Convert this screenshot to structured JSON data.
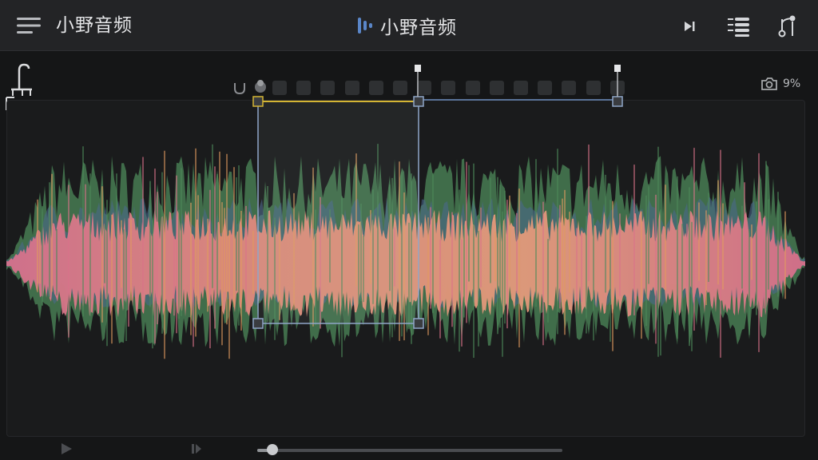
{
  "header": {
    "app_title": "小野音频",
    "center_title": "小野音频",
    "icons": {
      "menu": "hamburger-menu-icon",
      "logo": "audio-bars-logo-icon",
      "play_next": "skip-forward-icon",
      "tracks": "track-list-icon",
      "tools": "branch-tool-icon"
    }
  },
  "editor": {
    "zoom_level": "9%",
    "marker_icon": "split-marker-icon",
    "magnet_icon": "snap-magnet-icon",
    "camera_icon": "snapshot-camera-icon",
    "selection": {
      "start": 0.316,
      "end": 0.512
    },
    "colors": {
      "wave_primary": "#d9728a",
      "wave_secondary": "#4e8a5a",
      "wave_blue": "#4a6890",
      "wave_highlight": "#e09a60",
      "selection_primary": "#d4b534",
      "selection_secondary": "#8fa6c8"
    }
  },
  "transport": {
    "play_icon": "play-icon",
    "pause_icon": "pause-icon",
    "progress": 0.05
  }
}
